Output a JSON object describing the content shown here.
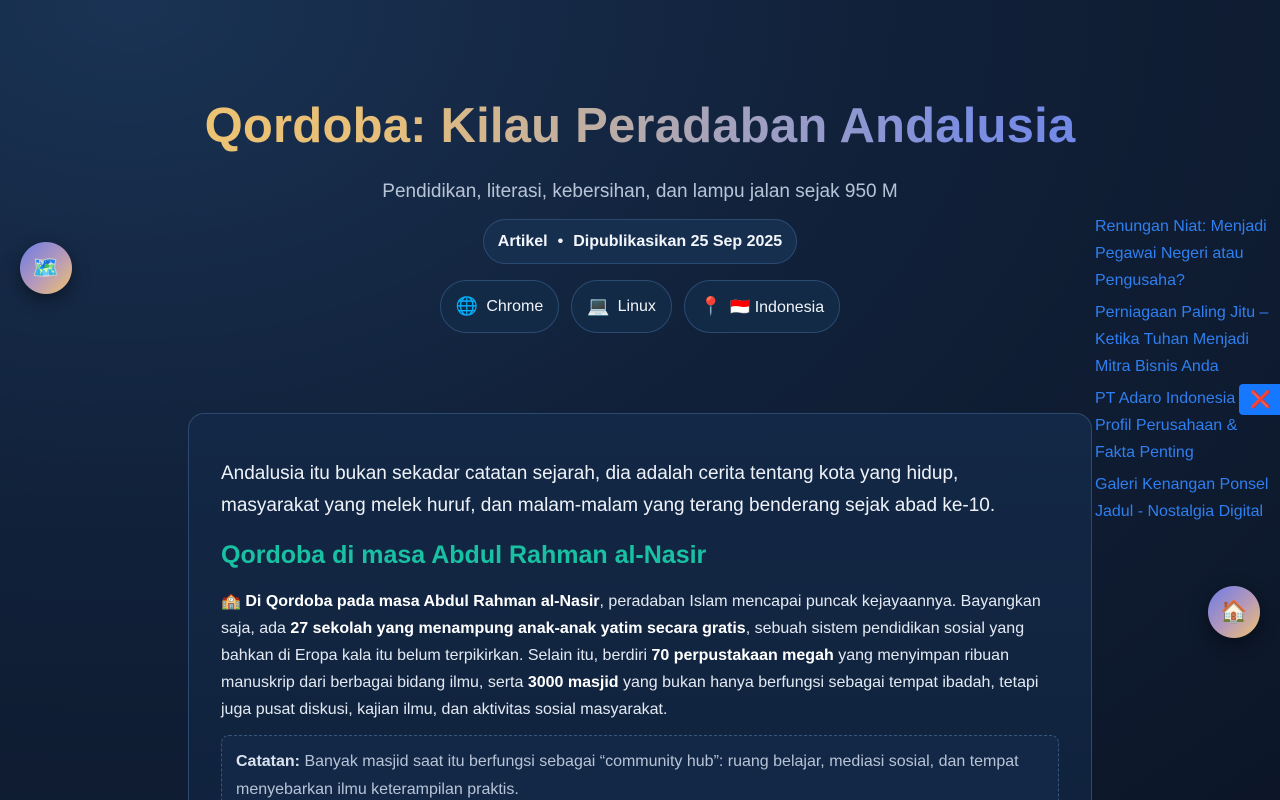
{
  "hero": {
    "title": "Qordoba: Kilau Peradaban Andalusia",
    "subtitle": "Pendidikan, literasi, kebersihan, dan lampu jalan sejak 950 M",
    "meta_type": "Artikel",
    "meta_sep": "•",
    "meta_date": "Dipublikasikan 25 Sep 2025"
  },
  "chips": [
    {
      "icon": "🌐",
      "icon_name": "globe-icon",
      "label": "Chrome"
    },
    {
      "icon": "💻",
      "icon_name": "laptop-icon",
      "label": "Linux"
    },
    {
      "icon": "📍",
      "icon_name": "pin-icon",
      "label": "🇮🇩 Indonesia"
    }
  ],
  "floating": {
    "map_icon": "🗺️",
    "home_icon": "🏠",
    "close_icon": "❌"
  },
  "sidebar": {
    "links": [
      "Renungan Niat: Menjadi Pegawai Negeri atau Pengusaha?",
      "Perniagaan Paling Jitu – Ketika Tuhan Menjadi Mitra Bisnis Anda",
      "PT Adaro Indonesia — Profil Perusahaan & Fakta Penting",
      "Galeri Kenangan Ponsel Jadul - Nostalgia Digital"
    ]
  },
  "article": {
    "lead": "Andalusia itu bukan sekadar catatan sejarah, dia adalah cerita tentang kota yang hidup, masyarakat yang melek huruf, dan malam-malam yang terang benderang sejak abad ke-10.",
    "heading": "Qordoba di masa Abdul Rahman al-Nasir",
    "p_icon": "🏫",
    "p_b1": "Di Qordoba pada masa Abdul Rahman al-Nasir",
    "p_t1": ", peradaban Islam mencapai puncak kejayaannya. Bayangkan saja, ada ",
    "p_b2": "27 sekolah yang menampung anak-anak yatim secara gratis",
    "p_t2": ", sebuah sistem pendidikan sosial yang bahkan di Eropa kala itu belum terpikirkan. Selain itu, berdiri ",
    "p_b3": "70 perpustakaan megah",
    "p_t3": " yang menyimpan ribuan manuskrip dari berbagai bidang ilmu, serta ",
    "p_b4": "3000 masjid",
    "p_t4": " yang bukan hanya berfungsi sebagai tempat ibadah, tetapi juga pusat diskusi, kajian ilmu, dan aktivitas sosial masyarakat.",
    "note_label": "Catatan:",
    "note_text": " Banyak masjid saat itu berfungsi sebagai “community hub”: ruang belajar, mediasi sosial, dan tempat menyebarkan ilmu keterampilan praktis."
  }
}
